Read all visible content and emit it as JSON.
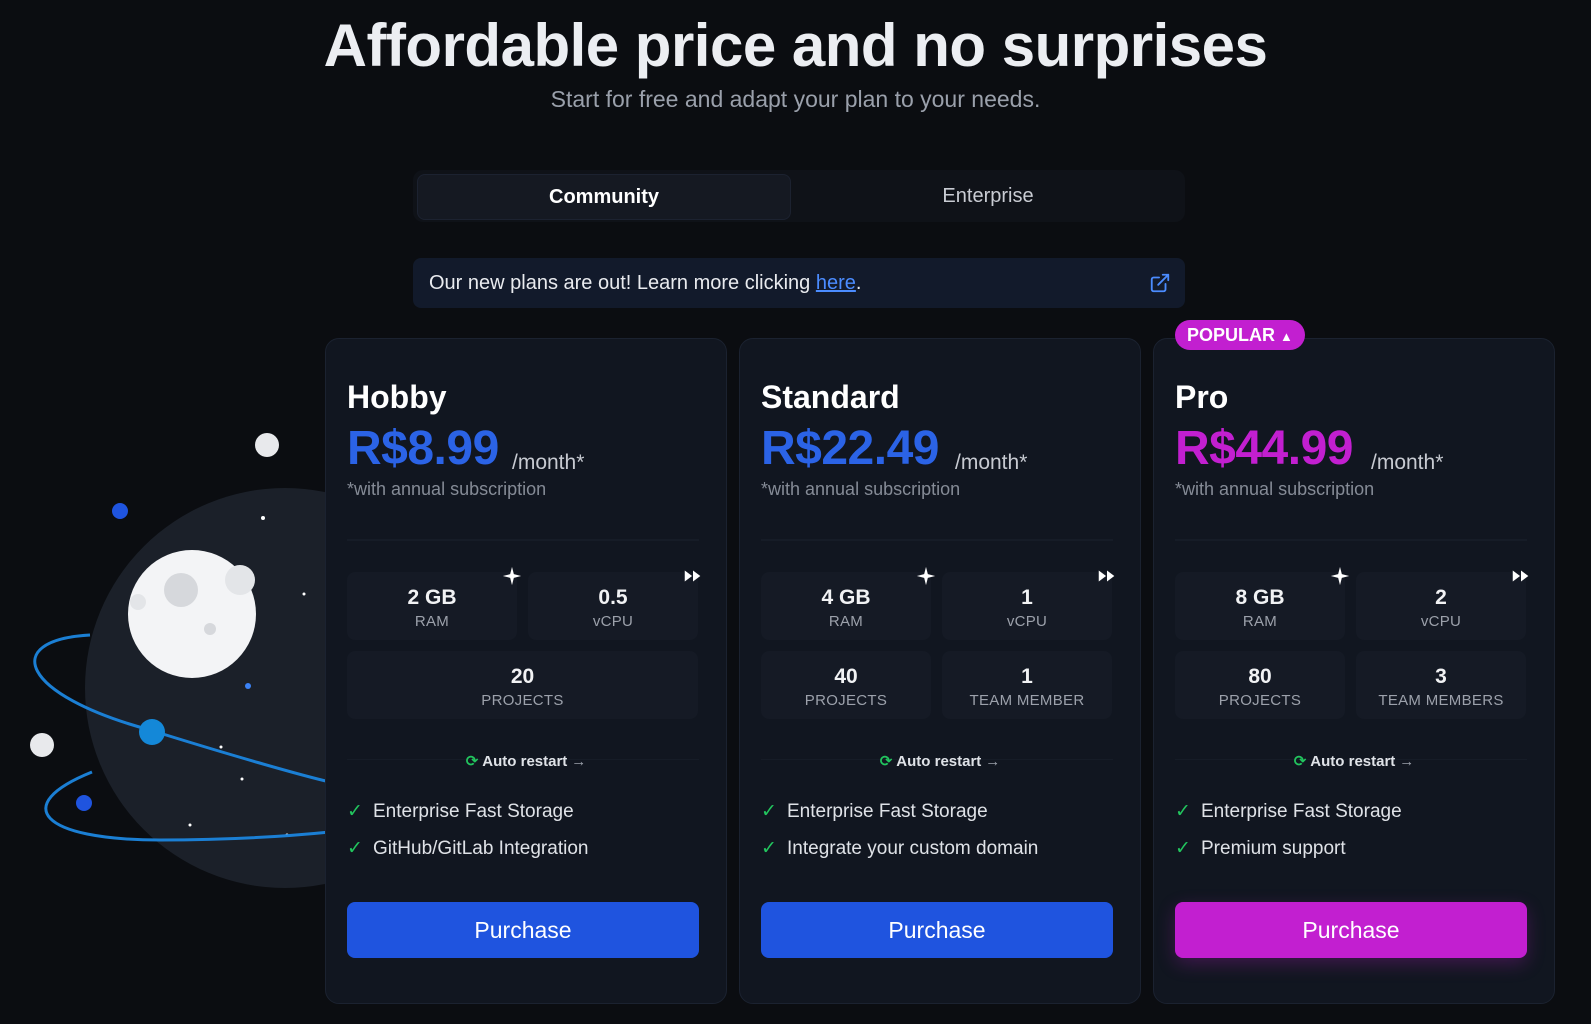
{
  "header": {
    "title": "Affordable price and no surprises",
    "subtitle": "Start for free and adapt your plan to your needs."
  },
  "tabs": [
    {
      "label": "Community",
      "active": true
    },
    {
      "label": "Enterprise",
      "active": false
    }
  ],
  "banner": {
    "text": "Our new plans are out! Learn more clicking ",
    "link": "here",
    "after": ".",
    "icon": "external-link-icon"
  },
  "colors": {
    "blue": "#1f54df",
    "magenta": "#c21fd0",
    "green": "#22c55e",
    "background": "#0b0d11",
    "card": "#111620"
  },
  "popular_badge": {
    "label": "POPULAR",
    "icon": "caret-up-icon"
  },
  "plans": [
    {
      "name": "Hobby",
      "price": "R$8.99",
      "per": "/month*",
      "note": "*with annual subscription",
      "accent": "#2b63e6",
      "specs": [
        {
          "value": "2 GB",
          "label": "RAM"
        },
        {
          "value": "0.5",
          "label": "vCPU"
        },
        {
          "value": "20",
          "label": "PROJECTS"
        }
      ],
      "auto_restart": "Auto restart",
      "features": [
        "Enterprise Fast Storage",
        "GitHub/GitLab Integration"
      ],
      "button": "Purchase"
    },
    {
      "name": "Standard",
      "price": "R$22.49",
      "per": "/month*",
      "note": "*with annual subscription",
      "accent": "#2b63e6",
      "specs": [
        {
          "value": "4 GB",
          "label": "RAM"
        },
        {
          "value": "1",
          "label": "vCPU"
        },
        {
          "value": "40",
          "label": "PROJECTS"
        },
        {
          "value": "1",
          "label": "TEAM MEMBER"
        }
      ],
      "auto_restart": "Auto restart",
      "features": [
        "Enterprise Fast Storage",
        "Integrate your custom domain"
      ],
      "button": "Purchase"
    },
    {
      "name": "Pro",
      "price": "R$44.99",
      "per": "/month*",
      "note": "*with annual subscription",
      "accent": "#c21fd0",
      "specs": [
        {
          "value": "8 GB",
          "label": "RAM"
        },
        {
          "value": "2",
          "label": "vCPU"
        },
        {
          "value": "80",
          "label": "PROJECTS"
        },
        {
          "value": "3",
          "label": "TEAM MEMBERS"
        }
      ],
      "auto_restart": "Auto restart",
      "features": [
        "Enterprise Fast Storage",
        "Premium support"
      ],
      "button": "Purchase"
    }
  ]
}
